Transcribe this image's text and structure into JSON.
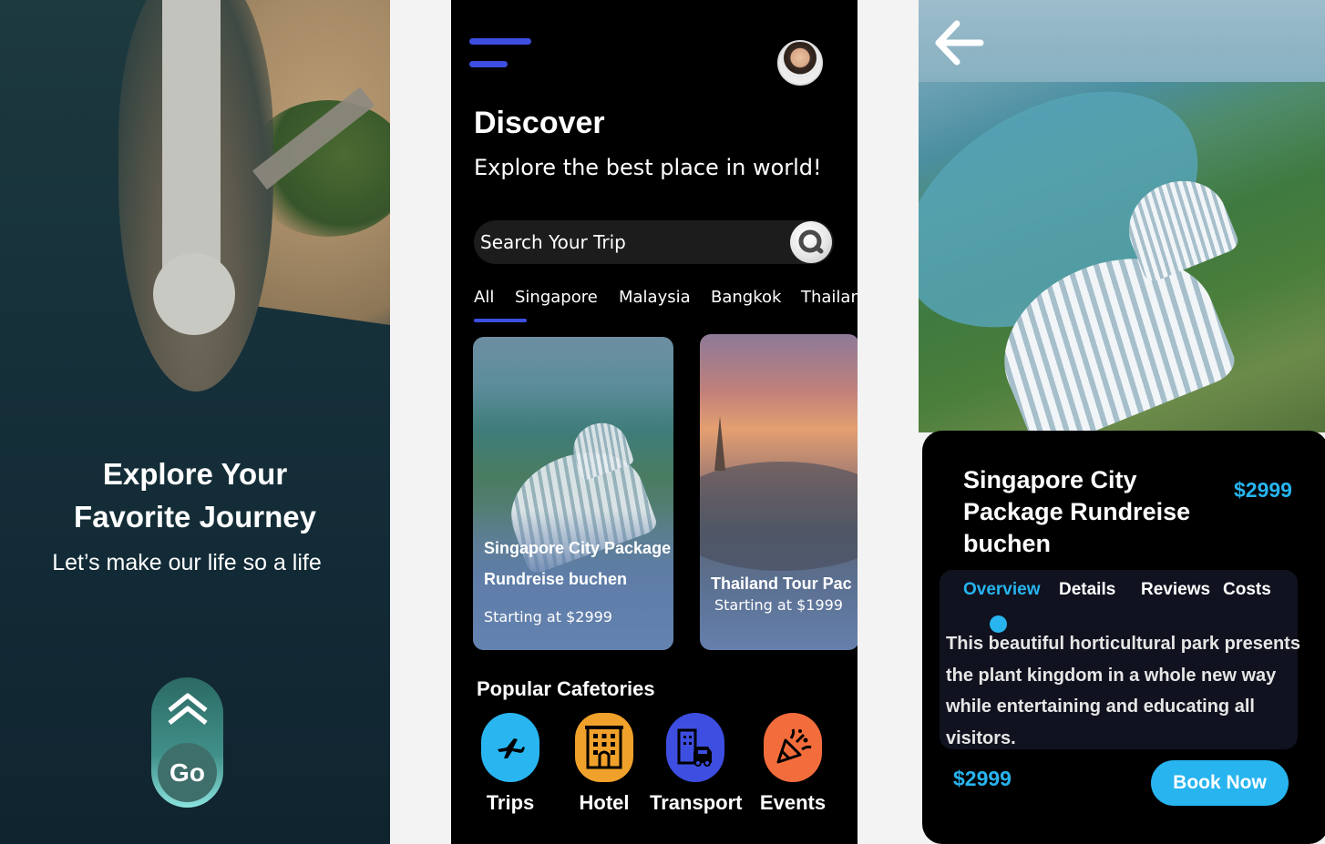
{
  "onboarding": {
    "title_line1": "Explore Your",
    "title_line2": "Favorite Journey",
    "subtitle": "Let’s make our life so a life",
    "go_label": "Go"
  },
  "discover": {
    "title": "Discover",
    "subtitle": "Explore the best place in world!",
    "search": {
      "placeholder": "Search Your Trip"
    },
    "tabs": [
      {
        "label": "All",
        "active": true
      },
      {
        "label": "Singapore"
      },
      {
        "label": "Malaysia"
      },
      {
        "label": "Bangkok"
      },
      {
        "label": "Thailan"
      }
    ],
    "cards": [
      {
        "title_line1": "Singapore City Package",
        "title_line2": "Rundreise buchen",
        "price": "Starting at $2999"
      },
      {
        "title_line1": "Thailand Tour Pac",
        "price": "Starting at $1999"
      }
    ],
    "categories_title": "Popular Cafetories",
    "categories": [
      {
        "label": "Trips",
        "icon": "airplane-icon",
        "color": "#29b6f0"
      },
      {
        "label": "Hotel",
        "icon": "hotel-icon",
        "color": "#f0a12b"
      },
      {
        "label": "Transport",
        "icon": "transport-icon",
        "color": "#3d4ee0"
      },
      {
        "label": "Events",
        "icon": "party-popper-icon",
        "color": "#f36d3c"
      }
    ]
  },
  "detail": {
    "title": "Singapore City Package Rundreise buchen",
    "price": "$2999",
    "tabs": [
      {
        "label": "Overview",
        "active": true
      },
      {
        "label": "Details"
      },
      {
        "label": "Reviews"
      },
      {
        "label": "Costs"
      }
    ],
    "description": "This  beautiful horticultural park presents the plant kingdom in a whole new way while entertaining and educating all visitors.",
    "bottom_price": "$2999",
    "book_label": "Book Now"
  },
  "colors": {
    "accent_blue": "#3d4ee0",
    "accent_cyan": "#27b4ef",
    "teal": "#41908a"
  }
}
